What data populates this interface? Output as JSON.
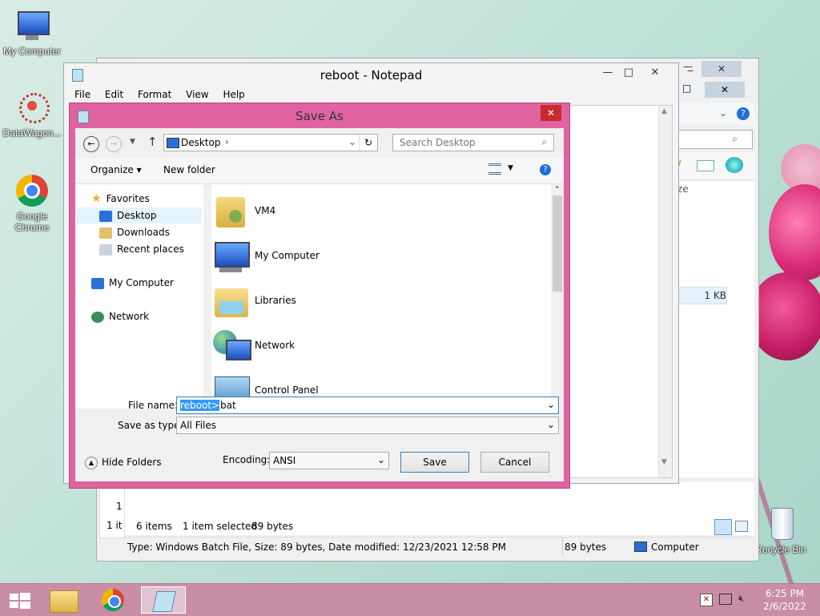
{
  "desktop": {
    "icons": [
      {
        "label": "My Computer",
        "icon": "monitor-icon"
      },
      {
        "label": "DataWagon...",
        "icon": "datawagon-icon"
      },
      {
        "label": "Google Chrome",
        "icon": "chrome-icon"
      },
      {
        "label": "Recycle Bin",
        "icon": "recycle-bin-icon"
      }
    ]
  },
  "explorer": {
    "size_label": "ze",
    "file_size": "1 KB",
    "status_items": "6 items",
    "status_selected": "1 item selected",
    "status_bytes": "89 bytes",
    "left_row_num": "1",
    "left_status": "1 it",
    "details": "Type: Windows Batch File, Size: 89 bytes, Date modified: 12/23/2021 12:58 PM",
    "details_size": "89 bytes",
    "details_location": "Computer"
  },
  "notepad": {
    "title": "reboot - Notepad",
    "menu": [
      "File",
      "Edit",
      "Format",
      "View",
      "Help"
    ]
  },
  "save_as": {
    "title": "Save As",
    "address": "Desktop",
    "search_placeholder": "Search Desktop",
    "organize": "Organize",
    "new_folder": "New folder",
    "nav": {
      "favorites": "Favorites",
      "desktop": "Desktop",
      "downloads": "Downloads",
      "recent": "Recent places",
      "my_computer": "My Computer",
      "network": "Network"
    },
    "files": [
      "VM4",
      "My Computer",
      "Libraries",
      "Network",
      "Control Panel"
    ],
    "file_name_label": "File name:",
    "file_name_selected": "reboot>",
    "file_name_rest": "bat",
    "save_type_label": "Save as type:",
    "save_type_value": "All Files",
    "hide_folders": "Hide Folders",
    "encoding_label": "Encoding:",
    "encoding_value": "ANSI",
    "save_button": "Save",
    "cancel_button": "Cancel"
  },
  "taskbar": {
    "time": "6:25 PM",
    "date": "2/6/2022"
  },
  "colors": {
    "dialog_frame": "#e062a0",
    "taskbar": "#c98da6",
    "selection": "#3399ff"
  }
}
